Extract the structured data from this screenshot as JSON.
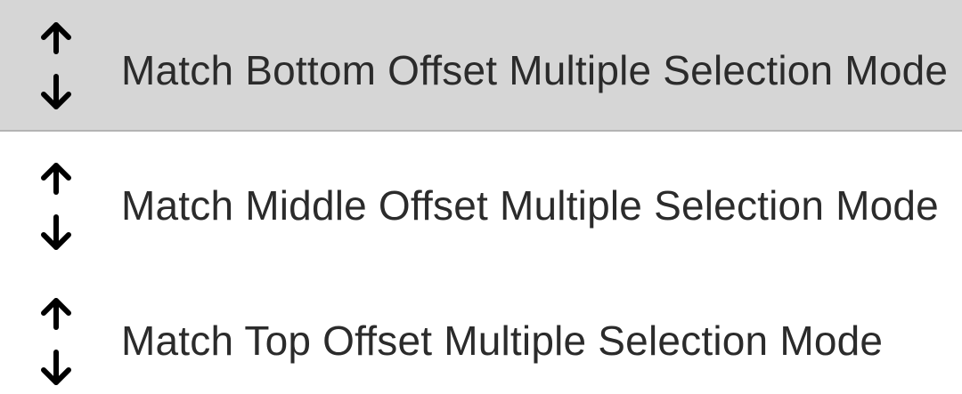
{
  "menu": {
    "items": [
      {
        "label": "Match Bottom Offset Multiple Selection Mode",
        "icon": "vertical-arrows-icon",
        "selected": true
      },
      {
        "label": "Match Middle Offset Multiple Selection Mode",
        "icon": "vertical-arrows-icon",
        "selected": false
      },
      {
        "label": "Match Top Offset Multiple Selection Mode",
        "icon": "vertical-arrows-icon",
        "selected": false
      }
    ]
  },
  "colors": {
    "selected_background": "#d6d6d6",
    "text": "#2b2b2b",
    "icon": "#000000"
  }
}
